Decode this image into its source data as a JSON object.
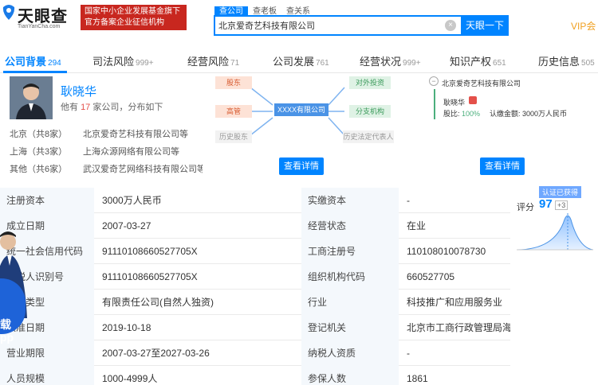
{
  "header": {
    "logo_text": "天眼查",
    "logo_en": "TianYanCha.com",
    "banner_line1": "国家中小企业发展基金旗下",
    "banner_line2": "官方备案企业征信机构",
    "search_tabs": [
      "查公司",
      "查老板",
      "查关系"
    ],
    "search_value": "北京爱奇艺科技有限公司",
    "search_button": "天眼一下",
    "vip": "VIP会"
  },
  "nav": [
    {
      "label": "公司背景",
      "count": "294"
    },
    {
      "label": "司法风险",
      "count": "999+"
    },
    {
      "label": "经营风险",
      "count": "71"
    },
    {
      "label": "公司发展",
      "count": "761"
    },
    {
      "label": "经营状况",
      "count": "999+"
    },
    {
      "label": "知识产权",
      "count": "651"
    },
    {
      "label": "历史信息",
      "count": "505"
    }
  ],
  "person": {
    "name": "耿晓华",
    "sub_prefix": "他有",
    "company_count": "17",
    "sub_suffix": "家公司，分布如下",
    "cities": [
      {
        "city": "北京（共8家）",
        "company": "北京爱奇艺科技有限公司等"
      },
      {
        "city": "上海（共3家）",
        "company": "上海众源网络有限公司等"
      },
      {
        "city": "其他（共6家）",
        "company": "武汉爱奇艺网络科技有限公司等"
      }
    ]
  },
  "diagram": {
    "shareholder": "股东",
    "executive": "高管",
    "history_shareholder": "历史股东",
    "center": "XXXX有限公司",
    "investment": "对外投资",
    "branch": "分支机构",
    "history_legal": "历史法定代表人",
    "detail_button": "查看详情"
  },
  "right_card": {
    "company": "北京爱奇艺科技有限公司",
    "person": "耿晓华",
    "ratio_label": "股比:",
    "ratio": "100%",
    "capital_label": "认缴金额:",
    "capital": "3000万人民币",
    "detail_button": "查看详情"
  },
  "info_rows": [
    {
      "l1": "注册资本",
      "v1": "3000万人民币",
      "l2": "实缴资本",
      "v2": "-"
    },
    {
      "l1": "成立日期",
      "v1": "2007-03-27",
      "l2": "经营状态",
      "v2": "在业"
    },
    {
      "l1": "统一社会信用代码",
      "v1": "91110108660527705X",
      "l2": "工商注册号",
      "v2": "110108010078730"
    },
    {
      "l1": "纳税人识别号",
      "v1": "91110108660527705X",
      "l2": "组织机构代码",
      "v2": "660527705"
    },
    {
      "l1": "公司类型",
      "v1": "有限责任公司(自然人独资)",
      "l2": "行业",
      "v2": "科技推广和应用服务业"
    },
    {
      "l1": "核准日期",
      "v1": "2019-10-18",
      "l2": "登记机关",
      "v2": "北京市工商行政管理局海淀分局"
    },
    {
      "l1": "营业期限",
      "v1": "2007-03-27至2027-03-26",
      "l2": "纳税人资质",
      "v2": "-"
    },
    {
      "l1": "人员规模",
      "v1": "1000-4999人",
      "l2": "参保人数",
      "v2": "1861"
    }
  ],
  "score": {
    "cert": "认证已获得",
    "label": "评分",
    "value": "97",
    "delta": "+3"
  },
  "promo": {
    "text_line1": "载",
    "text_line2": "pp"
  },
  "colors": {
    "accent": "#0084ff",
    "banner": "#c8271f",
    "label_bg": "#f4f8fc"
  }
}
